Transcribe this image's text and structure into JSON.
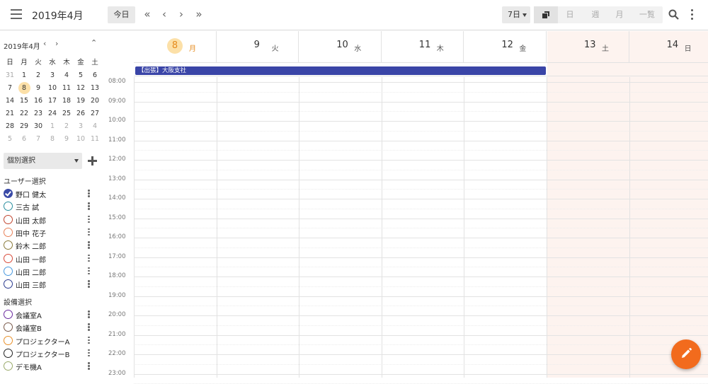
{
  "header": {
    "title": "2019年4月",
    "today_label": "今日",
    "view_select": "7日",
    "modes": [
      "日",
      "週",
      "月",
      "一覧"
    ]
  },
  "mini_calendar": {
    "title": "2019年4月",
    "weekdays": [
      "日",
      "月",
      "火",
      "水",
      "木",
      "金",
      "土"
    ],
    "weeks": [
      [
        "31",
        "1",
        "2",
        "3",
        "4",
        "5",
        "6"
      ],
      [
        "7",
        "8",
        "9",
        "10",
        "11",
        "12",
        "13"
      ],
      [
        "14",
        "15",
        "16",
        "17",
        "18",
        "19",
        "20"
      ],
      [
        "21",
        "22",
        "23",
        "24",
        "25",
        "26",
        "27"
      ],
      [
        "28",
        "29",
        "30",
        "1",
        "2",
        "3",
        "4"
      ],
      [
        "5",
        "6",
        "7",
        "8",
        "9",
        "10",
        "11"
      ]
    ]
  },
  "sidebar": {
    "select_label": "個別選択",
    "users_title": "ユーザー選択",
    "users": [
      {
        "name": "野口 健太",
        "color": "#3a4aa7",
        "checked": true
      },
      {
        "name": "三古 試",
        "color": "#2a8f9f",
        "checked": false
      },
      {
        "name": "山田 太郎",
        "color": "#c0452f",
        "checked": false
      },
      {
        "name": "田中 花子",
        "color": "#e8825a",
        "checked": false
      },
      {
        "name": "鈴木 二郎",
        "color": "#8a7a3a",
        "checked": false
      },
      {
        "name": "山田 一郎",
        "color": "#d84a3a",
        "checked": false
      },
      {
        "name": "山田 二郎",
        "color": "#4a9ae0",
        "checked": false
      },
      {
        "name": "山田 三郎",
        "color": "#2a3a8f",
        "checked": false
      }
    ],
    "facilities_title": "設備選択",
    "facilities": [
      {
        "name": "会議室A",
        "color": "#6a2a9f",
        "checked": false
      },
      {
        "name": "会議室B",
        "color": "#7a5a4a",
        "checked": false
      },
      {
        "name": "プロジェクターA",
        "color": "#e8902a",
        "checked": false
      },
      {
        "name": "プロジェクターB",
        "color": "#222222",
        "checked": false
      },
      {
        "name": "デモ機A",
        "color": "#9aaa6a",
        "checked": false
      }
    ]
  },
  "days": [
    {
      "num": "8",
      "dow": "月",
      "today": true
    },
    {
      "num": "9",
      "dow": "火"
    },
    {
      "num": "10",
      "dow": "水"
    },
    {
      "num": "11",
      "dow": "木"
    },
    {
      "num": "12",
      "dow": "金"
    },
    {
      "num": "13",
      "dow": "土"
    },
    {
      "num": "14",
      "dow": "日"
    }
  ],
  "event": {
    "label": "【出張】大阪支社",
    "color": "#3a45a7"
  },
  "hours": [
    "08:00",
    "09:00",
    "10:00",
    "11:00",
    "12:00",
    "13:00",
    "14:00",
    "15:00",
    "16:00",
    "17:00",
    "18:00",
    "19:00",
    "20:00",
    "21:00",
    "22:00",
    "23:00"
  ],
  "colors": {
    "today_bg": "#fce0a8",
    "today_fg": "#e58b1d",
    "weekend_bg": "#fdf3ef",
    "fab": "#f26b1d"
  }
}
